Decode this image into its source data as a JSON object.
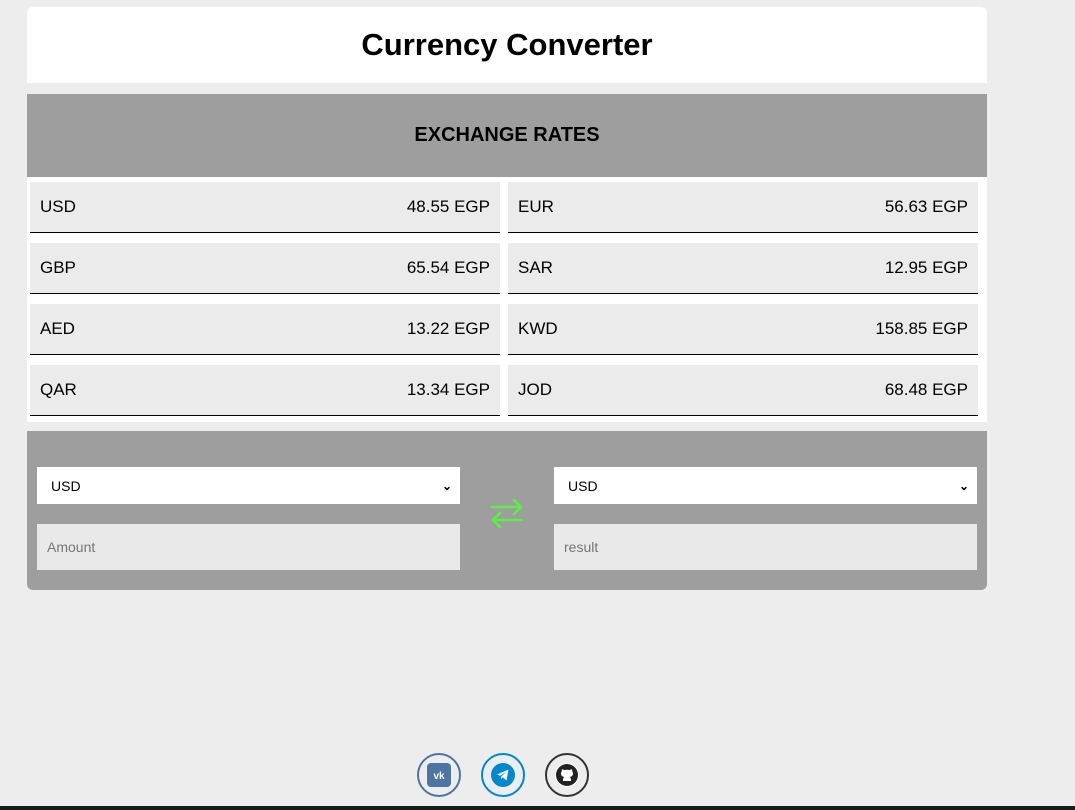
{
  "header": {
    "title": "Currency Converter"
  },
  "rates": {
    "heading": "EXCHANGE RATES",
    "items": [
      {
        "code": "USD",
        "value": "48.55 EGP"
      },
      {
        "code": "EUR",
        "value": "56.63 EGP"
      },
      {
        "code": "GBP",
        "value": "65.54 EGP"
      },
      {
        "code": "SAR",
        "value": "12.95 EGP"
      },
      {
        "code": "AED",
        "value": "13.22 EGP"
      },
      {
        "code": "KWD",
        "value": "158.85 EGP"
      },
      {
        "code": "QAR",
        "value": "13.34 EGP"
      },
      {
        "code": "JOD",
        "value": "68.48 EGP"
      }
    ]
  },
  "converter": {
    "from_currency": "USD",
    "to_currency": "USD",
    "amount_placeholder": "Amount",
    "result_placeholder": "result",
    "swap_icon": "swap-arrows-icon",
    "swap_color": "#5cf046"
  },
  "socials": [
    {
      "name": "vk-icon",
      "color": "#4c75a3"
    },
    {
      "name": "telegram-icon",
      "color": "#0088cc"
    },
    {
      "name": "github-icon",
      "color": "#333333"
    }
  ]
}
